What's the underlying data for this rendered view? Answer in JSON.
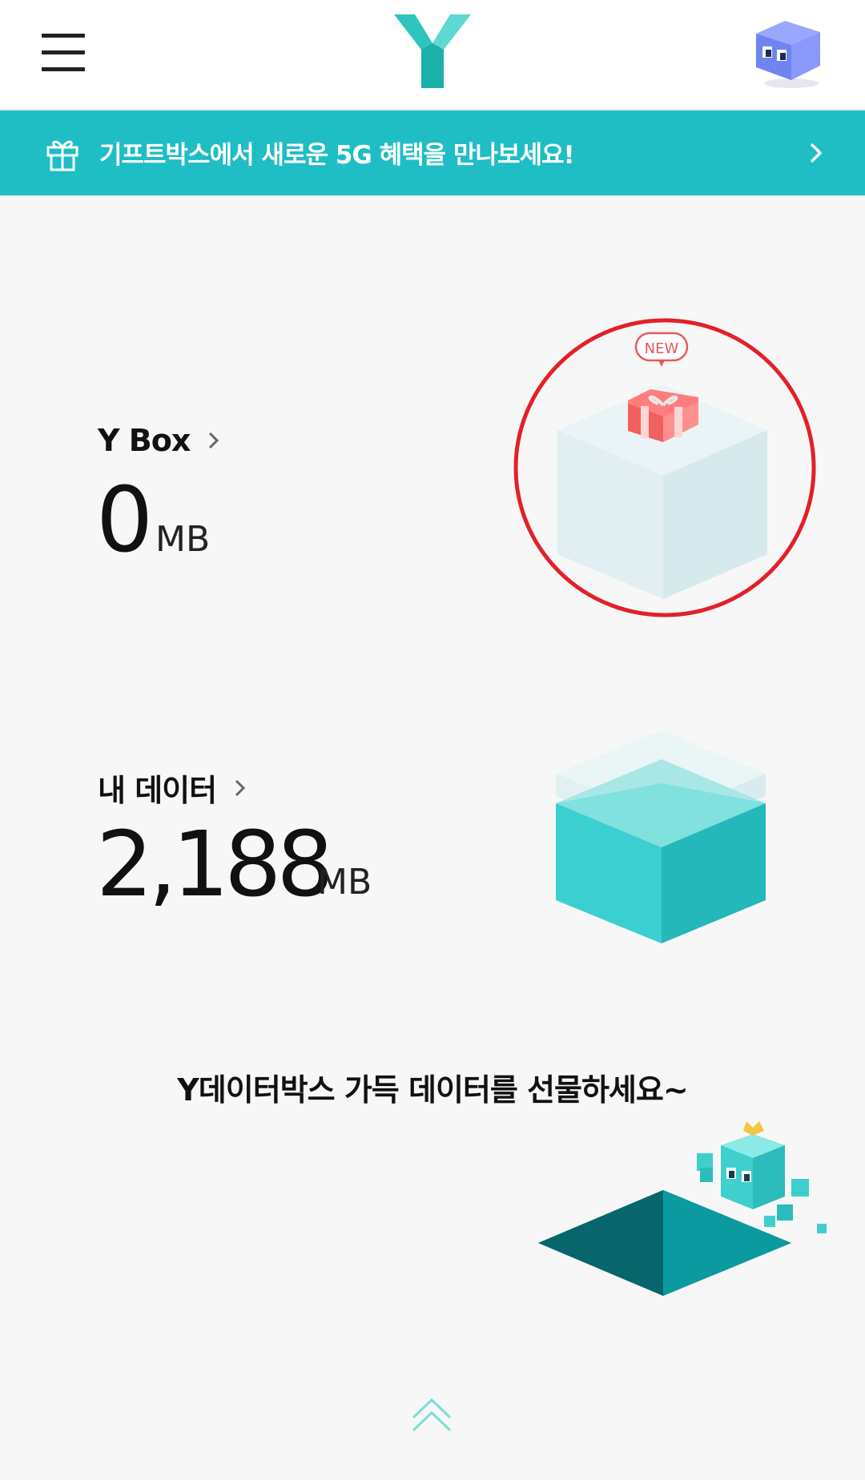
{
  "header": {
    "menu_icon": "hamburger-menu-icon",
    "logo_icon": "y-logo-icon",
    "avatar_icon": "cube-character-avatar-icon"
  },
  "banner": {
    "text": "기프트박스에서 새로운 5G 혜택을 만나보세요!",
    "icon": "gift-icon",
    "chevron": "chevron-right-icon",
    "background": "#1fbdc4"
  },
  "ybox": {
    "title": "Y Box",
    "value": "0",
    "unit": "MB",
    "badge": "NEW"
  },
  "my_data": {
    "title": "내 데이터",
    "value": "2,188",
    "unit": "MB"
  },
  "promo": {
    "text": "Y데이터박스 가득 데이터를 선물하세요~"
  },
  "colors": {
    "accent": "#1fbdc4",
    "highlight_circle": "#e3202a"
  }
}
